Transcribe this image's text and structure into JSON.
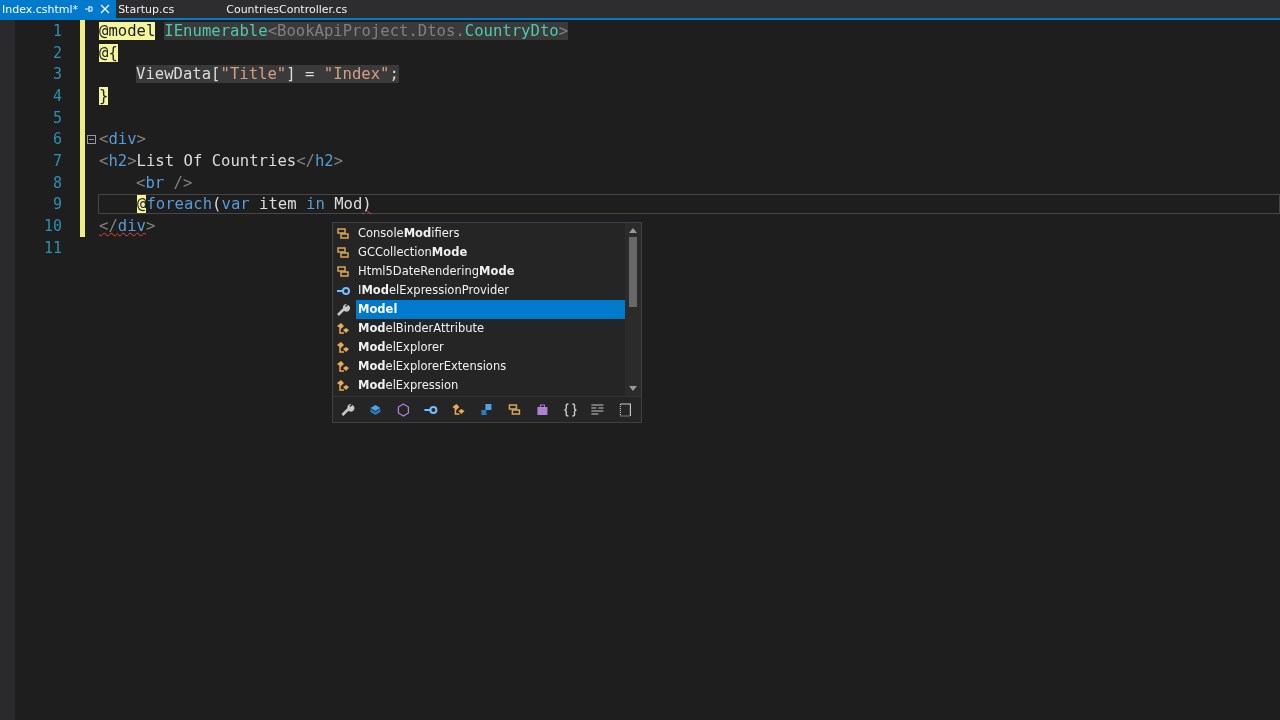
{
  "tabs": [
    {
      "label": "Index.cshtml*",
      "selected": true,
      "pinnable": true,
      "closable": true
    },
    {
      "label": "Startup.cs",
      "selected": false,
      "pinnable": false,
      "closable": false
    },
    {
      "label": "CountriesController.cs",
      "selected": false,
      "pinnable": false,
      "closable": false
    }
  ],
  "editor": {
    "lines": [
      {
        "number": "1",
        "current": false,
        "modified": true,
        "foldable": false,
        "indented": false,
        "tokens": [
          {
            "text": "@model",
            "kind": "razor",
            "shaded": false,
            "error": false
          },
          {
            "text": "IEnumerable",
            "kind": "type",
            "shaded": true,
            "error": false,
            "spaced": true
          },
          {
            "text": "<BookApiProject.Dtos.",
            "kind": "punct",
            "shaded": true,
            "error": false
          },
          {
            "text": "CountryDto",
            "kind": "type",
            "shaded": true,
            "error": false
          },
          {
            "text": ">",
            "kind": "punct",
            "shaded": true,
            "error": false
          }
        ]
      },
      {
        "number": "2",
        "current": false,
        "modified": true,
        "foldable": false,
        "indented": false,
        "tokens": [
          {
            "text": "@{",
            "kind": "razor",
            "shaded": false,
            "error": false
          }
        ]
      },
      {
        "number": "3",
        "current": false,
        "modified": true,
        "foldable": false,
        "indented": true,
        "tokens": [
          {
            "text": "ViewData[",
            "kind": "text",
            "shaded": true,
            "error": false
          },
          {
            "text": "\"Title\"",
            "kind": "string",
            "shaded": true,
            "error": false
          },
          {
            "text": "] = ",
            "kind": "text",
            "shaded": true,
            "error": false
          },
          {
            "text": "\"Index\"",
            "kind": "string",
            "shaded": true,
            "error": false
          },
          {
            "text": ";",
            "kind": "text",
            "shaded": true,
            "error": false
          }
        ]
      },
      {
        "number": "4",
        "current": false,
        "modified": true,
        "foldable": false,
        "indented": false,
        "tokens": [
          {
            "text": "}",
            "kind": "razor",
            "shaded": false,
            "error": false
          }
        ]
      },
      {
        "number": "5",
        "current": false,
        "modified": true,
        "foldable": false
      },
      {
        "number": "6",
        "current": false,
        "modified": true,
        "foldable": true,
        "indented": false,
        "tokens": [
          {
            "text": "<",
            "kind": "punct",
            "shaded": false,
            "error": false
          },
          {
            "text": "div",
            "kind": "tag",
            "shaded": false,
            "error": false
          },
          {
            "text": ">",
            "kind": "punct",
            "shaded": false,
            "error": false
          }
        ]
      },
      {
        "number": "7",
        "current": false,
        "modified": true,
        "foldable": false,
        "indented": false,
        "tokens": [
          {
            "text": "<",
            "kind": "punct",
            "shaded": false,
            "error": false
          },
          {
            "text": "h2",
            "kind": "tag",
            "shaded": false,
            "error": false
          },
          {
            "text": ">",
            "kind": "punct",
            "shaded": false,
            "error": false
          },
          {
            "text": "List Of Countries",
            "kind": "text",
            "shaded": false,
            "error": false
          },
          {
            "text": "</",
            "kind": "punct",
            "shaded": false,
            "error": false
          },
          {
            "text": "h2",
            "kind": "tag",
            "shaded": false,
            "error": false
          },
          {
            "text": ">",
            "kind": "punct",
            "shaded": false,
            "error": false
          }
        ]
      },
      {
        "number": "8",
        "current": false,
        "modified": true,
        "foldable": false,
        "indented": true,
        "tokens": [
          {
            "text": "<",
            "kind": "punct",
            "shaded": false,
            "error": false
          },
          {
            "text": "br",
            "kind": "tag",
            "shaded": false,
            "error": false
          },
          {
            "text": " />",
            "kind": "punct",
            "shaded": false,
            "error": false
          }
        ]
      },
      {
        "number": "9",
        "current": true,
        "modified": true,
        "foldable": false,
        "indented": true,
        "tokens": [
          {
            "text": "@",
            "kind": "razor",
            "shaded": false,
            "error": false
          },
          {
            "text": "foreach",
            "kind": "keyword",
            "shaded": false,
            "error": false
          },
          {
            "text": "(",
            "kind": "text",
            "shaded": false,
            "error": false
          },
          {
            "text": "var",
            "kind": "keyword",
            "shaded": false,
            "error": false
          },
          {
            "text": " item ",
            "kind": "text",
            "shaded": false,
            "error": false
          },
          {
            "text": "in",
            "kind": "keyword",
            "shaded": false,
            "error": false
          },
          {
            "text": " Mod",
            "kind": "text",
            "shaded": false,
            "error": false
          },
          {
            "text": ")",
            "kind": "text",
            "shaded": false,
            "error": true
          }
        ]
      },
      {
        "number": "10",
        "current": false,
        "modified": true,
        "foldable": false,
        "indented": false,
        "tokens": [
          {
            "text": "</",
            "kind": "punct",
            "shaded": false,
            "error": true
          },
          {
            "text": "div",
            "kind": "tag",
            "shaded": false,
            "error": true
          },
          {
            "text": ">",
            "kind": "punct",
            "shaded": false,
            "error": false
          }
        ]
      },
      {
        "number": "11",
        "current": false,
        "modified": false,
        "foldable": false
      }
    ]
  },
  "completion": {
    "items": [
      {
        "label": "Console**Mod**ifiers",
        "kind": "enum",
        "selected": false
      },
      {
        "label": "GCCollection**Mode**",
        "kind": "enum",
        "selected": false
      },
      {
        "label": "Html5DateRendering**Mode**",
        "kind": "enum",
        "selected": false
      },
      {
        "label": "I**Mod**elExpressionProvider",
        "kind": "interface",
        "selected": false
      },
      {
        "label": "**Model**",
        "kind": "property",
        "selected": true
      },
      {
        "label": "**Mod**elBinderAttribute",
        "kind": "class",
        "selected": false
      },
      {
        "label": "**Mod**elExplorer",
        "kind": "class",
        "selected": false
      },
      {
        "label": "**Mod**elExplorerExtensions",
        "kind": "class",
        "selected": false
      },
      {
        "label": "**Mod**elExpression",
        "kind": "class",
        "selected": false
      }
    ],
    "filters": [
      {
        "kind": "property"
      },
      {
        "kind": "field"
      },
      {
        "kind": "event"
      },
      {
        "kind": "interface"
      },
      {
        "kind": "class"
      },
      {
        "kind": "method"
      },
      {
        "kind": "enum"
      },
      {
        "kind": "struct"
      },
      {
        "kind": "namespace"
      },
      {
        "kind": "snippet"
      },
      {
        "kind": "expand"
      }
    ]
  }
}
